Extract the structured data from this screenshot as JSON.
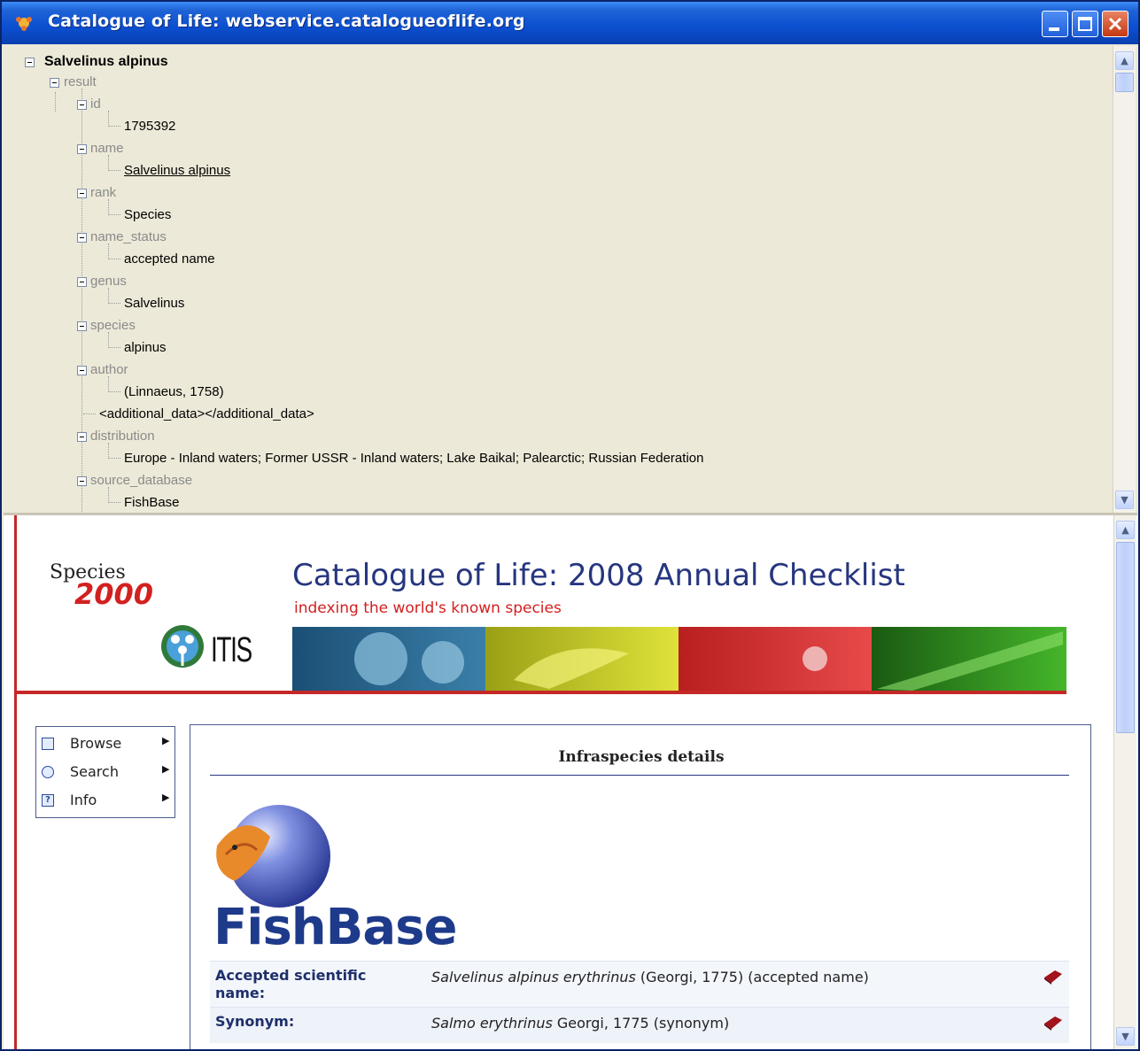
{
  "window": {
    "title": "Catalogue of Life: webservice.catalogueoflife.org"
  },
  "tree": {
    "root": "Salvelinus alpinus",
    "result_label": "result",
    "nodes": [
      {
        "tag": "id",
        "value": "1795392"
      },
      {
        "tag": "name",
        "value": "Salvelinus alpinus"
      },
      {
        "tag": "rank",
        "value": "Species"
      },
      {
        "tag": "name_status",
        "value": "accepted name"
      },
      {
        "tag": "genus",
        "value": "Salvelinus"
      },
      {
        "tag": "species",
        "value": "alpinus"
      },
      {
        "tag": "author",
        "value": "(Linnaeus, 1758)"
      },
      {
        "tag": "distribution",
        "value": "Europe - Inland waters; Former USSR - Inland waters; Lake Baikal; Palearctic; Russian Federation"
      },
      {
        "tag": "source_database",
        "value": "FishBase"
      }
    ],
    "additional_data": "<additional_data></additional_data>"
  },
  "page": {
    "species_logo_top": "Species",
    "species_logo_bottom": "2000",
    "itis_logo": "ITIS",
    "title": "Catalogue of Life: 2008 Annual Checklist",
    "subtitle": "indexing the world's known species"
  },
  "menu": {
    "items": [
      {
        "label": "Browse",
        "icon": "browse-icon"
      },
      {
        "label": "Search",
        "icon": "search-icon"
      },
      {
        "label": "Info",
        "icon": "info-icon"
      }
    ]
  },
  "details": {
    "heading": "Infraspecies details",
    "source_logo": "FishBase",
    "rows": [
      {
        "label": "Accepted scientific name:",
        "name": "Salvelinus alpinus erythrinus",
        "rest": " (Georgi, 1775) (accepted name)"
      },
      {
        "label": "Synonym:",
        "name": "Salmo erythrinus",
        "rest": " Georgi, 1775 (synonym)"
      }
    ]
  },
  "colors": {
    "titlebar": "#0b4fd0",
    "accent_red": "#c62828",
    "navy": "#26367f"
  }
}
